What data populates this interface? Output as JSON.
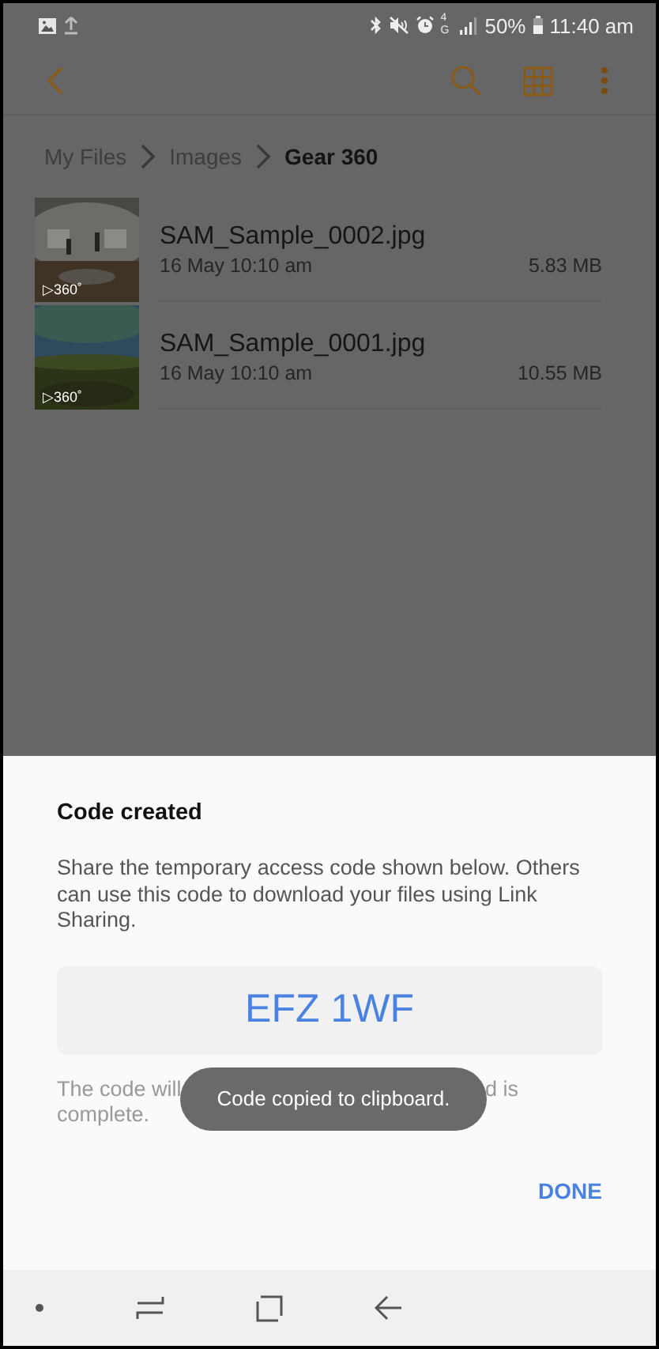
{
  "status_bar": {
    "network": "4G",
    "battery": "50%",
    "time": "11:40 am"
  },
  "breadcrumb": [
    {
      "label": "My Files",
      "current": false
    },
    {
      "label": "Images",
      "current": false
    },
    {
      "label": "Gear 360",
      "current": true
    }
  ],
  "files": [
    {
      "name": "SAM_Sample_0002.jpg",
      "date": "16 May 10:10 am",
      "size": "5.83 MB",
      "badge": "▷360˚",
      "kind": "picture"
    },
    {
      "name": "SAM_Sample_0001.jpg",
      "date": "16 May 10:10 am",
      "size": "10.55 MB",
      "badge": "▷360˚",
      "kind": "picture"
    }
  ],
  "dialog": {
    "title": "Code created",
    "message": "Share the temporary access code shown below. Others can use this code to download your files using Link Sharing.",
    "code": "EFZ 1WF",
    "note_start": "The code will",
    "note_end": "d is",
    "note_last": "complete.",
    "button": "DONE"
  },
  "toast": "Code copied to clipboard."
}
